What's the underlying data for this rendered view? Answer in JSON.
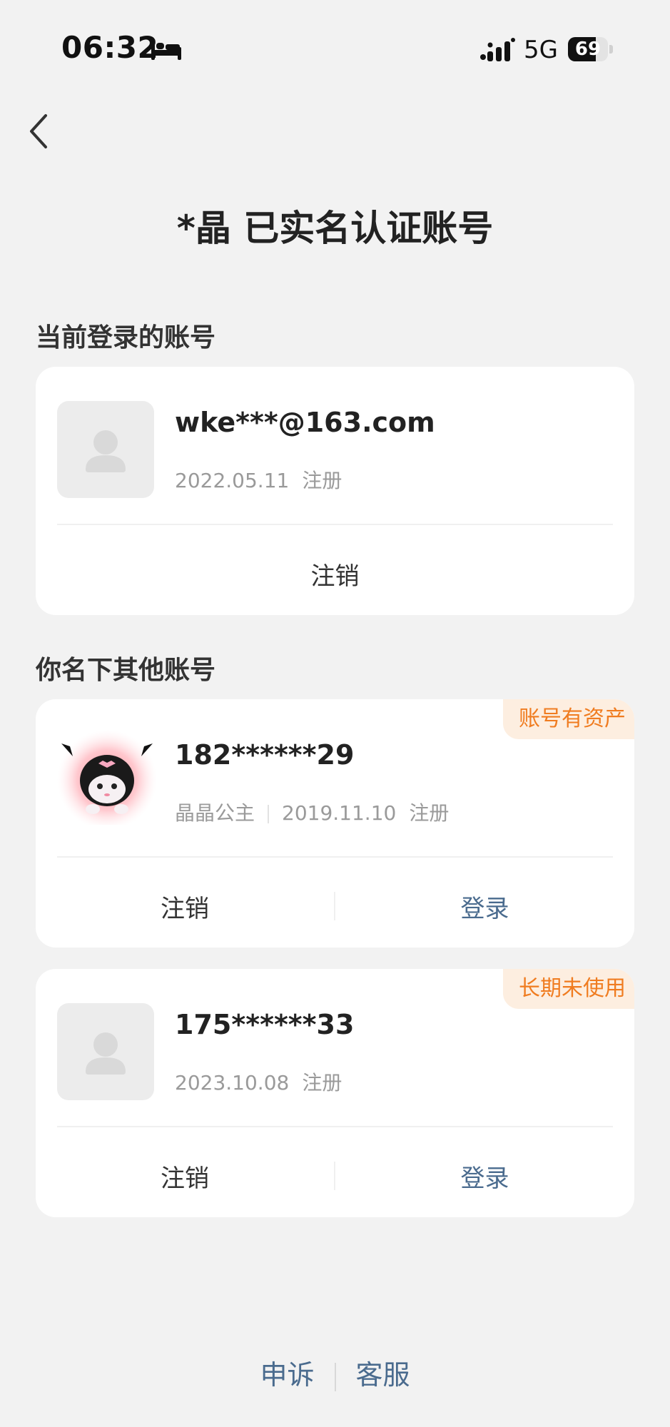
{
  "status_bar": {
    "time": "06:32",
    "network": "5G",
    "battery": "69",
    "battery_level": 0.69
  },
  "header": {
    "title": "*晶 已实名认证账号"
  },
  "current_section": {
    "label": "当前登录的账号",
    "account": {
      "name": "wke***@163.com",
      "date": "2022.05.11",
      "register_label": "注册",
      "cancel_label": "注销"
    }
  },
  "other_section": {
    "label": "你名下其他账号",
    "accounts": [
      {
        "name": "182******29",
        "nickname": "晶晶公主",
        "date": "2019.11.10",
        "register_label": "注册",
        "badge": "账号有资产",
        "cancel_label": "注销",
        "login_label": "登录"
      },
      {
        "name": "175******33",
        "date": "2023.10.08",
        "register_label": "注册",
        "badge": "长期未使用",
        "cancel_label": "注销",
        "login_label": "登录"
      }
    ]
  },
  "footer": {
    "appeal": "申诉",
    "service": "客服"
  },
  "colors": {
    "background": "#f2f2f2",
    "link_blue": "#4a6b8e",
    "badge_orange": "#f07c20",
    "badge_bg": "#fdeee0"
  }
}
